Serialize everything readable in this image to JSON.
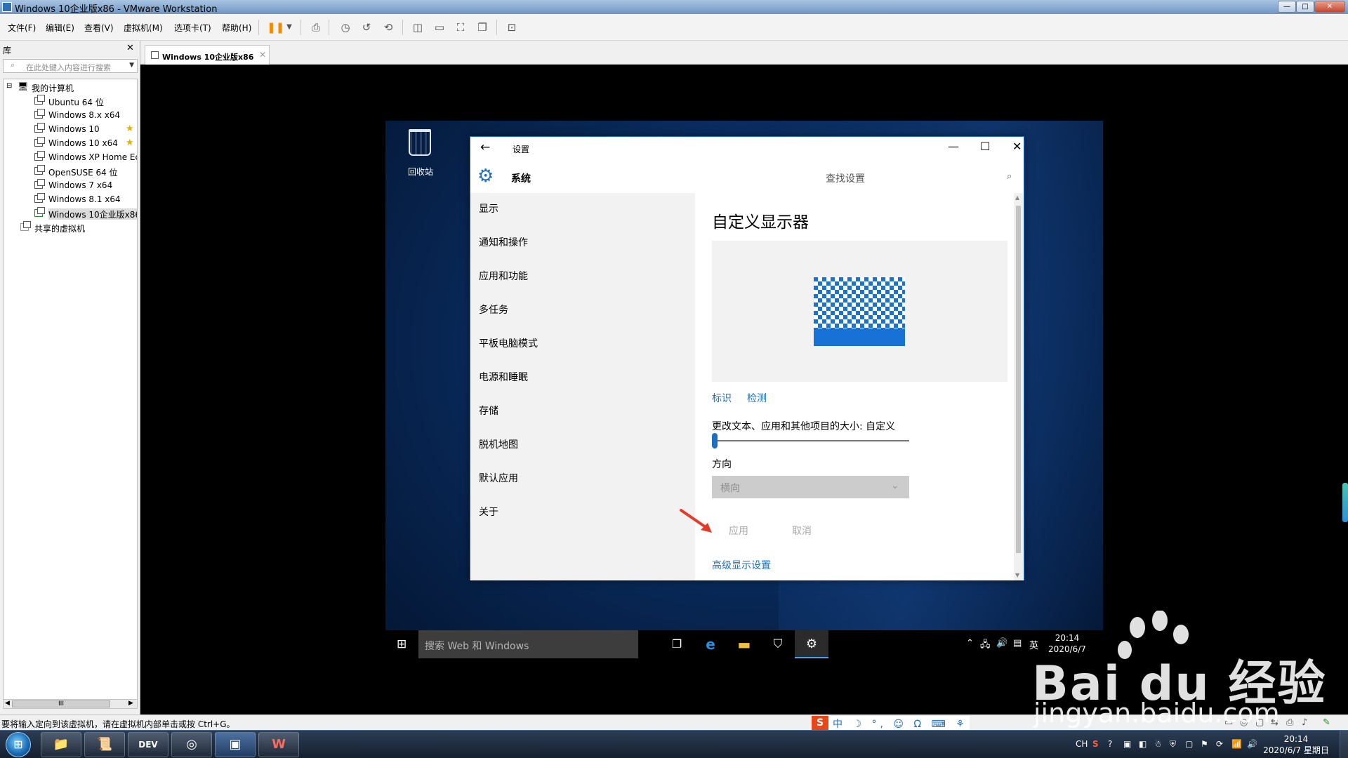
{
  "window": {
    "title": "Windows 10企业版x86 - VMware Workstation",
    "controls": [
      "—",
      "□",
      "✕"
    ]
  },
  "menubar": {
    "items": [
      "文件(F)",
      "编辑(E)",
      "查看(V)",
      "虚拟机(M)",
      "选项卡(T)",
      "帮助(H)"
    ]
  },
  "library": {
    "title": "库",
    "close": "✕",
    "search_placeholder": "在此处键入内容进行搜索",
    "root": "我的计算机",
    "vms": [
      {
        "label": "Ubuntu 64 位",
        "favorite": false
      },
      {
        "label": "Windows 8.x x64",
        "favorite": false
      },
      {
        "label": "Windows 10",
        "favorite": true
      },
      {
        "label": "Windows 10 x64",
        "favorite": true
      },
      {
        "label": "Windows XP Home Ec",
        "favorite": false
      },
      {
        "label": "OpenSUSE 64 位",
        "favorite": false
      },
      {
        "label": "Windows 7 x64",
        "favorite": false
      },
      {
        "label": "Windows 8.1 x64",
        "favorite": false
      },
      {
        "label": "Windows 10企业版x86",
        "favorite": false,
        "selected": true
      }
    ],
    "shared": "共享的虚拟机",
    "scroll_grip": "III"
  },
  "vm_tab": {
    "label": "Windows 10企业版x86",
    "close": "✕"
  },
  "desktop": {
    "recycle_bin": "回收站"
  },
  "settings": {
    "back": "←",
    "window_title": "设置",
    "controls": [
      "—",
      "☐",
      "✕"
    ],
    "section": "系统",
    "search_placeholder": "查找设置",
    "nav": [
      "显示",
      "通知和操作",
      "应用和功能",
      "多任务",
      "平板电脑模式",
      "电源和睡眠",
      "存储",
      "脱机地图",
      "默认应用",
      "关于"
    ],
    "heading": "自定义显示器",
    "identify": "标识",
    "detect": "检测",
    "scale_label": "更改文本、应用和其他项目的大小: 自定义",
    "scale_position": 0,
    "orientation_label": "方向",
    "orientation_value": "横向",
    "apply": "应用",
    "cancel": "取消",
    "advanced_link": "高级显示设置"
  },
  "guest_taskbar": {
    "search_placeholder": "搜索 Web 和 Windows",
    "ime": "英",
    "time": "20:14",
    "date": "2020/6/7"
  },
  "vm_status": {
    "message": "要将输入定向到该虚拟机，请在虚拟机内部单击或按 Ctrl+G。",
    "ime_logo": "S",
    "ime_text": "中 ☽ °, ☺ Ω ⌨ ⚘ ♥ ▦"
  },
  "host_taskbar": {
    "apps": [
      "📁",
      "📜",
      "DEV",
      "◎",
      "▣",
      "W"
    ],
    "ime": "CH",
    "time": "20:14",
    "date": "2020/6/7 星期日"
  },
  "watermark": {
    "brand": "Bai du 经验",
    "url": "jingyan.baidu.com"
  },
  "colors": {
    "accent": "#1f6fc0",
    "ime_red": "#e8471a"
  }
}
